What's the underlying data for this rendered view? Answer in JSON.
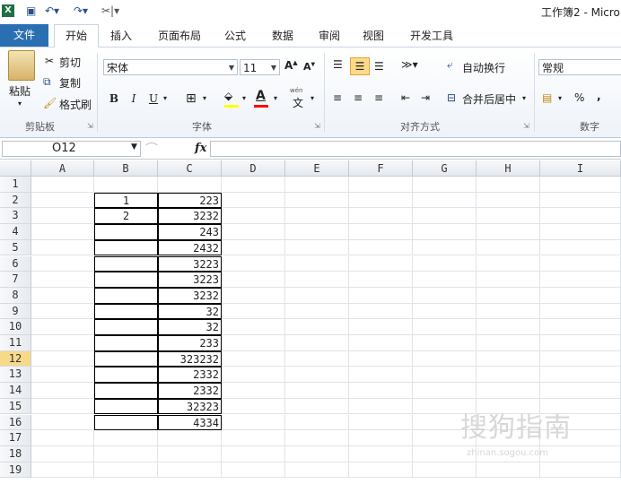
{
  "title_bar": {
    "title": "工作簿2 - Micro",
    "qat_icons": [
      "excel-app-icon",
      "save-icon",
      "undo-icon",
      "redo-icon",
      "customize-icon"
    ]
  },
  "tabs": [
    {
      "label": "文件"
    },
    {
      "label": "开始"
    },
    {
      "label": "插入"
    },
    {
      "label": "页面布局"
    },
    {
      "label": "公式"
    },
    {
      "label": "数据"
    },
    {
      "label": "审阅"
    },
    {
      "label": "视图"
    },
    {
      "label": "开发工具"
    }
  ],
  "ribbon": {
    "clipboard": {
      "paste": "粘贴",
      "cut": "剪切",
      "copy": "复制",
      "format_painter": "格式刷",
      "group": "剪贴板"
    },
    "font": {
      "name": "宋体",
      "size": "11",
      "bold": "B",
      "italic": "I",
      "underline": "U",
      "font_color_letter": "A",
      "group": "字体",
      "phonetic": "wén"
    },
    "alignment": {
      "wrap_text": "自动换行",
      "merge_center": "合并后居中",
      "group": "对齐方式"
    },
    "number": {
      "format": "常规",
      "percent": "%",
      "comma": ",",
      "group": "数字"
    },
    "colors": {
      "accent": "#2b6fb3",
      "fill": "#ffff00",
      "font_red": "#ff0000"
    }
  },
  "formula_bar": {
    "name_box": "O12",
    "fx": "fx",
    "value": ""
  },
  "columns": [
    "A",
    "B",
    "C",
    "D",
    "E",
    "F",
    "G",
    "H",
    "I"
  ],
  "rows": [
    "1",
    "2",
    "3",
    "4",
    "5",
    "6",
    "7",
    "8",
    "9",
    "10",
    "11",
    "12",
    "13",
    "14",
    "15",
    "16",
    "17",
    "18",
    "19"
  ],
  "active_row": "12",
  "table": {
    "b_values": [
      "1",
      "2",
      "",
      "",
      "",
      "",
      "",
      "",
      "",
      "",
      "",
      "",
      "",
      "",
      ""
    ],
    "c_values": [
      "223",
      "3232",
      "243",
      "2432",
      "3223",
      "3223",
      "3232",
      "32",
      "32",
      "233",
      "323232",
      "2332",
      "2332",
      "32323",
      "4334"
    ]
  },
  "watermark": {
    "text": "搜狗指南",
    "url": "zhinan.sogou.com"
  }
}
